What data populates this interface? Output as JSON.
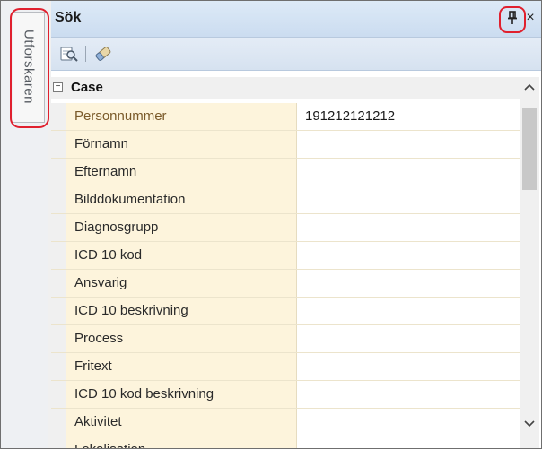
{
  "sidebar": {
    "tab_label": "Utforskaren"
  },
  "panel": {
    "title": "Sök",
    "pin_glyph": "Ⱨ",
    "close_glyph": "×"
  },
  "toolbar": {
    "search_icon": "search-icon",
    "clear_icon": "eraser-icon"
  },
  "grid": {
    "category": {
      "toggle": "−",
      "label": "Case"
    },
    "rows": [
      {
        "name": "Personnummer",
        "value": "191212121212"
      },
      {
        "name": "Förnamn",
        "value": ""
      },
      {
        "name": "Efternamn",
        "value": ""
      },
      {
        "name": "Bilddokumentation",
        "value": ""
      },
      {
        "name": "Diagnosgrupp",
        "value": ""
      },
      {
        "name": "ICD 10 kod",
        "value": ""
      },
      {
        "name": "Ansvarig",
        "value": ""
      },
      {
        "name": "ICD 10 beskrivning",
        "value": ""
      },
      {
        "name": "Process",
        "value": ""
      },
      {
        "name": "Fritext",
        "value": ""
      },
      {
        "name": "ICD 10 kod beskrivning",
        "value": ""
      },
      {
        "name": "Aktivitet",
        "value": ""
      },
      {
        "name": "Lokalisation",
        "value": ""
      }
    ]
  },
  "colors": {
    "highlight_ring": "#e0202e",
    "name_cell_bg": "#fdf4dc",
    "titlebar_bg": "#cbdcf0"
  }
}
